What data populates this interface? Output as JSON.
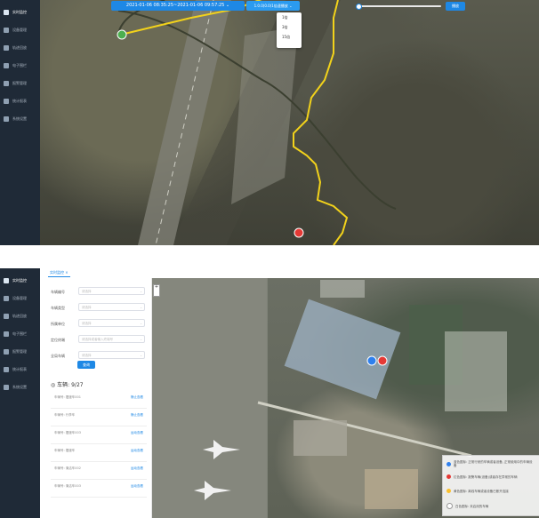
{
  "sidebar": {
    "items": [
      {
        "label": "实时监控",
        "icon": "monitor-icon"
      },
      {
        "label": "设备管理",
        "icon": "device-icon"
      },
      {
        "label": "轨迹回放",
        "icon": "location-pin-icon"
      },
      {
        "label": "电子围栏",
        "icon": "fence-icon"
      },
      {
        "label": "报警管理",
        "icon": "alarm-bell-icon"
      },
      {
        "label": "统计报表",
        "icon": "chart-icon"
      },
      {
        "label": "系统设置",
        "icon": "gear-icon"
      }
    ]
  },
  "playback": {
    "range_label": "2021-01-06 08:35:25~2021-01-06 09:57:25",
    "speed_label": "1.0.0(0.0)1倍速播放",
    "speed_options": [
      "1倍",
      "3倍",
      "15倍"
    ],
    "play_label": "播放"
  },
  "tabs": {
    "current": "实时监控"
  },
  "search": {
    "fields": [
      {
        "label": "车辆编号",
        "placeholder": "请选择"
      },
      {
        "label": "车辆类型",
        "placeholder": "请选择"
      },
      {
        "label": "所属单位",
        "placeholder": "请选择"
      },
      {
        "label": "定位终端",
        "placeholder": "请选择或者输入终端号"
      },
      {
        "label": "全局车辆",
        "placeholder": "请选择"
      }
    ],
    "query_label": "查询"
  },
  "vehicles": {
    "count_label": "车辆: 9/27",
    "rows": [
      {
        "name": "车辆号: 摆渡车001",
        "action": "静止查看"
      },
      {
        "name": "车辆号: 行李车",
        "action": "静止查看"
      },
      {
        "name": "车辆号: 摆渡车003",
        "action": "运动查看"
      },
      {
        "name": "车辆号: 摆渡车",
        "action": "运动查看"
      },
      {
        "name": "车辆号: 清洁车002",
        "action": "运动查看"
      },
      {
        "name": "车辆号: 清洁车003",
        "action": "运动查看"
      }
    ]
  },
  "legend": {
    "items": [
      {
        "text": "蓝色图标: 正常行驶的车辆或者设备, 正常使用中的车辆设备",
        "color": "#2f80ed"
      },
      {
        "text": "红色图标: 报警车辆(设备)或者存在异常的车辆",
        "color": "#e53935"
      },
      {
        "text": "黄色图标: 离线车辆或者设备已断开连接",
        "color": "#fbc02d"
      },
      {
        "text": "白色图标: 未启用的车辆",
        "color": "#ffffff"
      }
    ]
  },
  "colors": {
    "accent": "#1e88e5",
    "sidebar": "#1f2a37",
    "track": "#f2d21b"
  }
}
